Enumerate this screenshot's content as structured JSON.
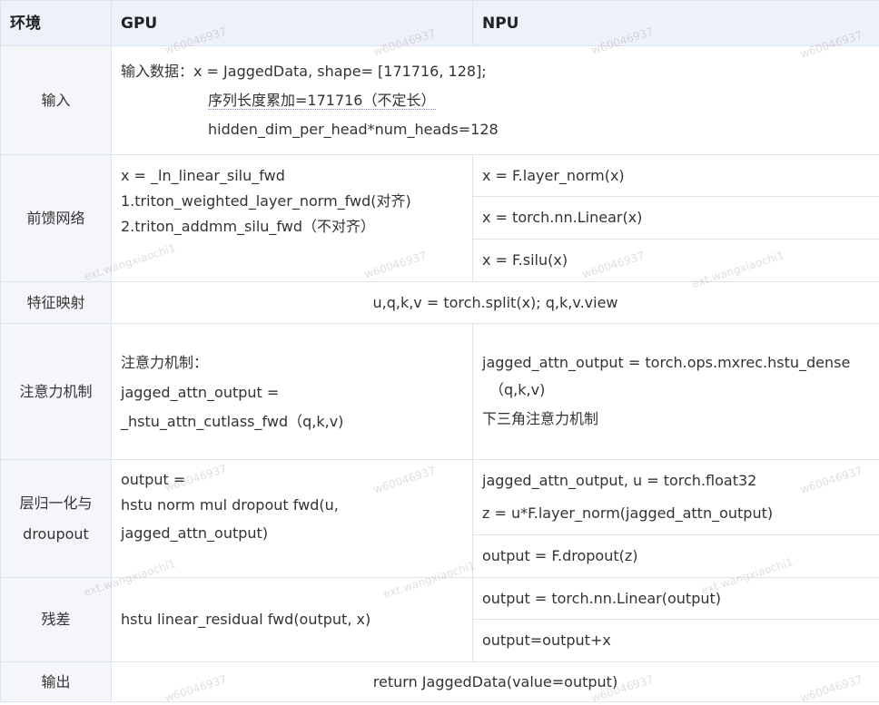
{
  "headers": {
    "env": "环境",
    "gpu": "GPU",
    "npu": "NPU"
  },
  "rows": {
    "input": {
      "label": "输入",
      "gpu": [
        "输入数据：x = JaggedData,  shape=  [171716, 128];",
        "序列长度累加=171716（不定长）",
        "hidden_dim_per_head*num_heads=128"
      ]
    },
    "ffn": {
      "label": "前馈网络",
      "gpu": [
        "x = _ln_linear_silu_fwd",
        "1.triton_weighted_layer_norm_fwd(对齐)",
        "2.triton_addmm_silu_fwd（不对齐）"
      ],
      "npu": [
        "x = F.layer_norm(x)",
        "x = torch.nn.Linear(x)",
        "x = F.silu(x)"
      ]
    },
    "feat": {
      "label": "特征映射",
      "shared": "u,q,k,v = torch.split(x);    q,k,v.view"
    },
    "attn": {
      "label": "注意力机制",
      "gpu": [
        "注意力机制：",
        "jagged_attn_output  =",
        "_hstu_attn_cutlass_fwd（q,k,v)"
      ],
      "npu": [
        "jagged_attn_output = torch.ops.mxrec.hstu_dense",
        "（q,k,v)",
        "下三角注意力机制"
      ]
    },
    "norm": {
      "label": [
        "层归一化与",
        "droupout"
      ],
      "gpu": [
        "output =",
        "hstu norm mul dropout fwd(u,",
        "jagged_attn_output)"
      ],
      "npu": [
        "jagged_attn_output, u = torch.float32",
        "z = u*F.layer_norm(jagged_attn_output)",
        "output = F.dropout(z)"
      ]
    },
    "res": {
      "label": "残差",
      "gpu": "hstu linear_residual fwd(output, x)",
      "npu": [
        "output = torch.nn.Linear(output)",
        "output=output+x"
      ]
    },
    "out": {
      "label": "输出",
      "shared": "return JaggedData(value=output)"
    }
  },
  "watermarks": [
    "w60046937",
    "ext.wangxiaochi1"
  ]
}
